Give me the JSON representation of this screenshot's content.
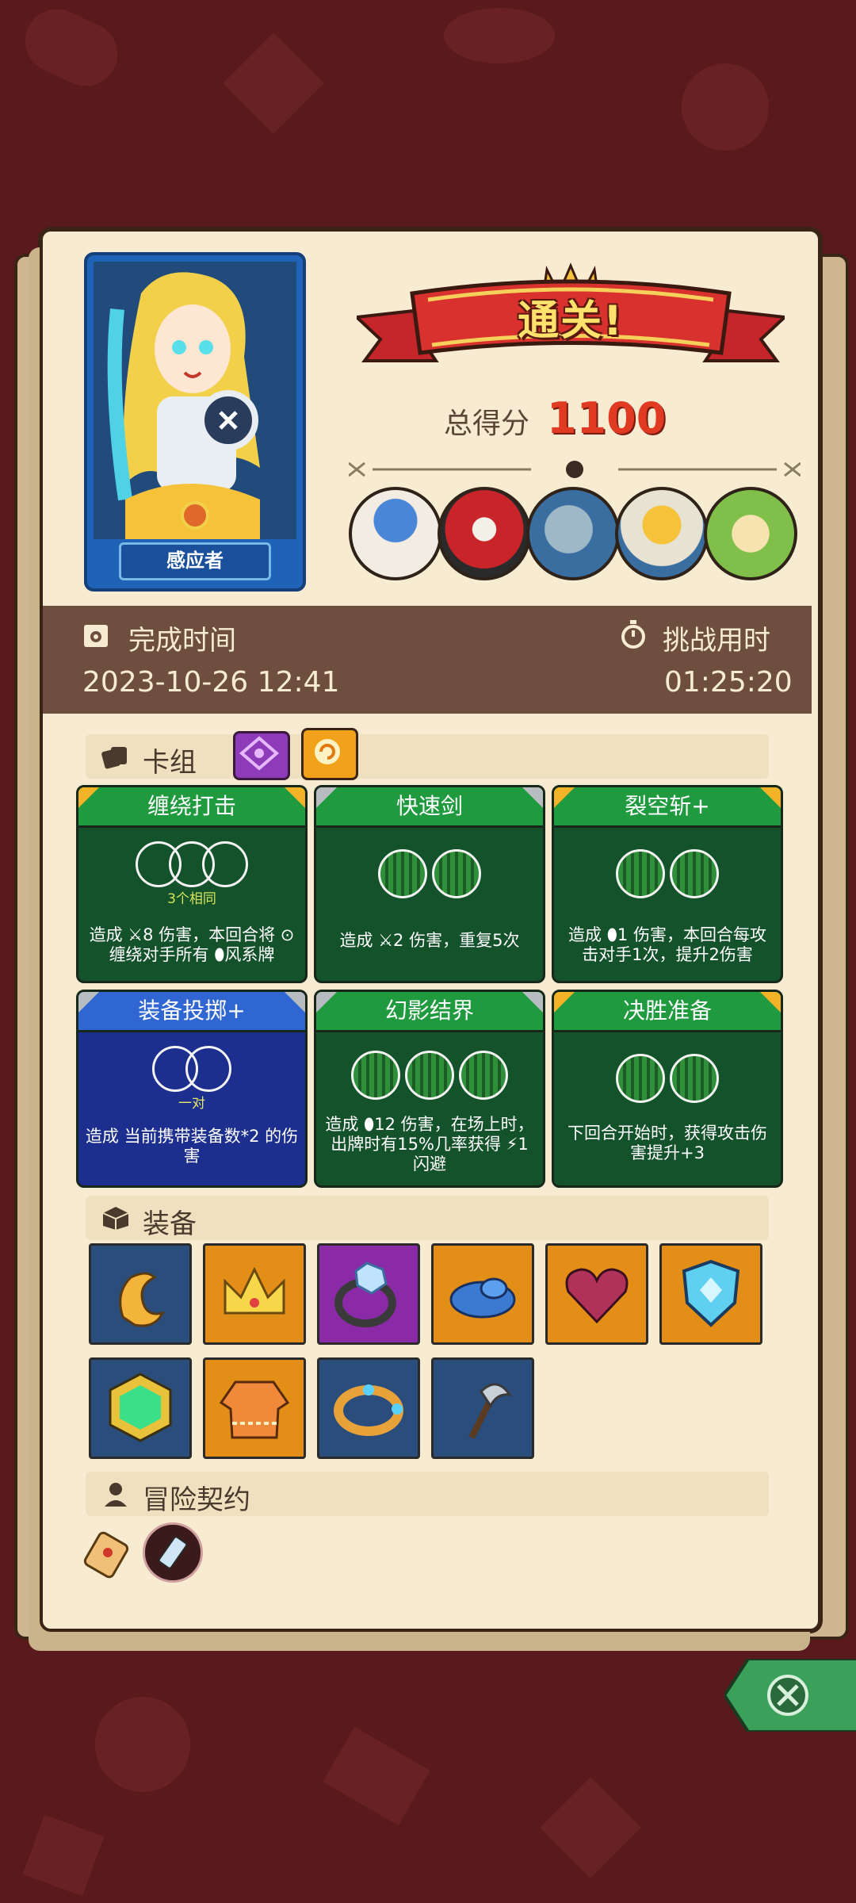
{
  "hero": {
    "name": "感应者"
  },
  "result": {
    "banner": "通关!",
    "score_label": "总得分",
    "score_value": "1100"
  },
  "bosses": [
    {
      "icon": "mushroom-sage-icon"
    },
    {
      "icon": "red-demon-icon"
    },
    {
      "icon": "fish-monster-icon"
    },
    {
      "icon": "golden-robot-icon"
    },
    {
      "icon": "forest-elf-icon"
    }
  ],
  "times": {
    "complete_label": "完成时间",
    "complete_value": "2023-10-26 12:41",
    "challenge_label": "挑战用时",
    "challenge_value": "01:25:20"
  },
  "deck": {
    "label": "卡组",
    "cards": [
      {
        "title": "缠绕打击",
        "note": "3个相同",
        "desc": "造成 ⚔8 伤害，本回合将 ⊙缠绕对手所有 ⬮风系牌"
      },
      {
        "title": "快速剑",
        "desc": "造成 ⚔2 伤害，重复5次"
      },
      {
        "title": "裂空斩+",
        "desc": "造成 ⬮1 伤害，本回合每攻击对手1次，提升2伤害"
      },
      {
        "title": "装备投掷+",
        "note": "一对",
        "desc": "造成 当前携带装备数*2 的伤害"
      },
      {
        "title": "幻影结界",
        "desc": "造成 ⬮12 伤害，在场上时，出牌时有15%几率获得 ⚡1 闪避"
      },
      {
        "title": "决胜准备",
        "desc": "下回合开始时，获得攻击伤害提升+3"
      }
    ]
  },
  "equipment": {
    "label": "装备",
    "items": [
      {
        "icon": "golden-claw-icon",
        "color": "blue"
      },
      {
        "icon": "golden-crown-icon",
        "color": "orange"
      },
      {
        "icon": "diamond-ring-icon",
        "color": "purple"
      },
      {
        "icon": "blue-slime-icon",
        "color": "orange"
      },
      {
        "icon": "cursed-heart-icon",
        "color": "orange"
      },
      {
        "icon": "crystal-shield-icon",
        "color": "orange"
      },
      {
        "icon": "emerald-gem-icon",
        "color": "blue"
      },
      {
        "icon": "knit-sweater-icon",
        "color": "orange"
      },
      {
        "icon": "jeweled-bracelet-icon",
        "color": "blue"
      },
      {
        "icon": "scythe-blade-icon",
        "color": "blue"
      }
    ]
  },
  "contracts": {
    "label": "冒险契约",
    "items": [
      {
        "icon": "scroll-icon"
      },
      {
        "icon": "potion-vial-icon"
      }
    ]
  }
}
